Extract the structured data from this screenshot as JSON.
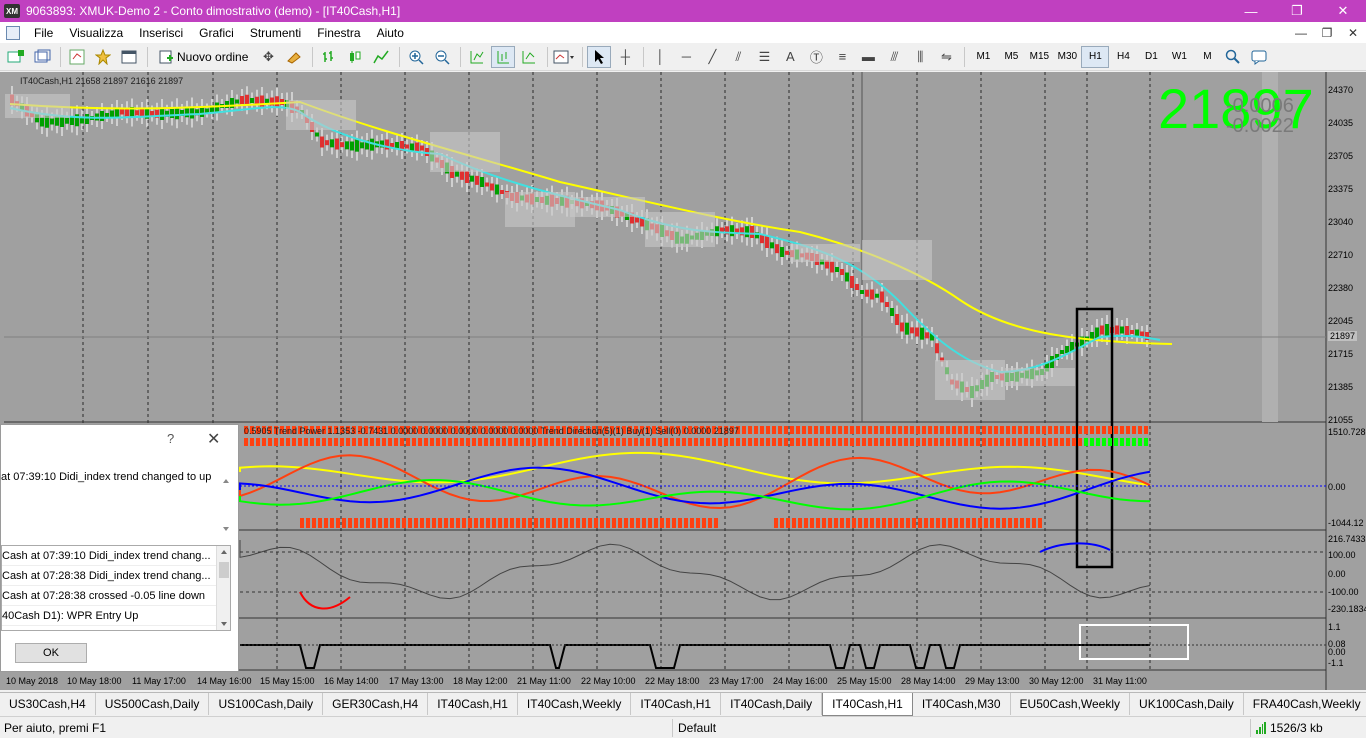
{
  "window": {
    "title": "9063893: XMUK-Demo 2 - Conto dimostrativo (demo) - [IT40Cash,H1]",
    "app_icon": "XM",
    "minimize_glyph": "—",
    "restore_glyph": "❐",
    "close_glyph": "✕"
  },
  "menu": {
    "items": [
      "File",
      "Visualizza",
      "Inserisci",
      "Grafici",
      "Strumenti",
      "Finestra",
      "Aiuto"
    ],
    "mdi_controls": [
      "—",
      "❐",
      "✕"
    ]
  },
  "toolbar": {
    "new_order_label": "Nuovo ordine",
    "timeframes": [
      "M1",
      "M5",
      "M15",
      "M30",
      "H1",
      "H4",
      "D1",
      "W1",
      "M"
    ],
    "active_timeframe": "H1"
  },
  "chart": {
    "symbol_info": "IT40Cash,H1  21658 21897 21616 21897",
    "big_price": "21897",
    "overlay_value_1": "-0.0006",
    "overlay_value_2": "-0.0022",
    "indicator_info": "0.5905  Trend Power 1.1353  -0.7431  0.0000  0.0000  0.0000  0.0000  0.0000  Trend Direction(5)(1)  Buy(1)  Sell(0)  0.0000  21897",
    "price_axis": [
      "24370",
      "24035",
      "23705",
      "23375",
      "23040",
      "22710",
      "22380",
      "22045",
      "21897",
      "21715",
      "21385",
      "21055"
    ],
    "current_price_label": "21897",
    "ind1_axis": [
      "1510.728",
      "0.00",
      "-1044.12"
    ],
    "ind2_axis": [
      "216.7433",
      "100.00",
      "0.00",
      "-100.00",
      "-230.1834"
    ],
    "ind3_axis": [
      "1.1",
      "0.08",
      "0.00",
      "-1.1"
    ],
    "time_axis": [
      "10 May 2018",
      "10 May 18:00",
      "11 May 17:00",
      "14 May 16:00",
      "15 May 15:00",
      "16 May 14:00",
      "17 May 13:00",
      "18 May 12:00",
      "21 May 11:00",
      "22 May 10:00",
      "22 May 18:00",
      "23 May 17:00",
      "24 May 16:00",
      "25 May 15:00",
      "28 May 14:00",
      "29 May 13:00",
      "30 May 12:00",
      "31 May 11:00"
    ],
    "colors": {
      "background": "#a0a0a0",
      "bull": "#00a000",
      "bear": "#e03030",
      "ma_fast": "#40e0e0",
      "ma_slow": "#ffff00",
      "big_price": "#00ff00"
    }
  },
  "dialog": {
    "help_glyph": "?",
    "close_glyph": "✕",
    "message": "at 07:39:10 Didi_index trend changed to up",
    "alerts": [
      "Cash at 07:39:10 Didi_index trend chang...",
      "Cash at 07:28:38 Didi_index trend chang...",
      "Cash at 07:28:38 crossed -0.05 line down",
      "40Cash D1): WPR Entry Up"
    ],
    "ok_label": "OK"
  },
  "tabs": {
    "items": [
      "US30Cash,H4",
      "US500Cash,Daily",
      "US100Cash,Daily",
      "GER30Cash,H4",
      "IT40Cash,H1",
      "IT40Cash,Weekly",
      "IT40Cash,H1",
      "IT40Cash,Daily",
      "IT40Cash,H1",
      "IT40Cash,M30",
      "EU50Cash,Weekly",
      "UK100Cash,Daily",
      "FRA40Cash,Weekly"
    ],
    "active_index": 8
  },
  "status": {
    "help": "Per aiuto, premi F1",
    "profile": "Default",
    "connection": "1526/3 kb"
  }
}
